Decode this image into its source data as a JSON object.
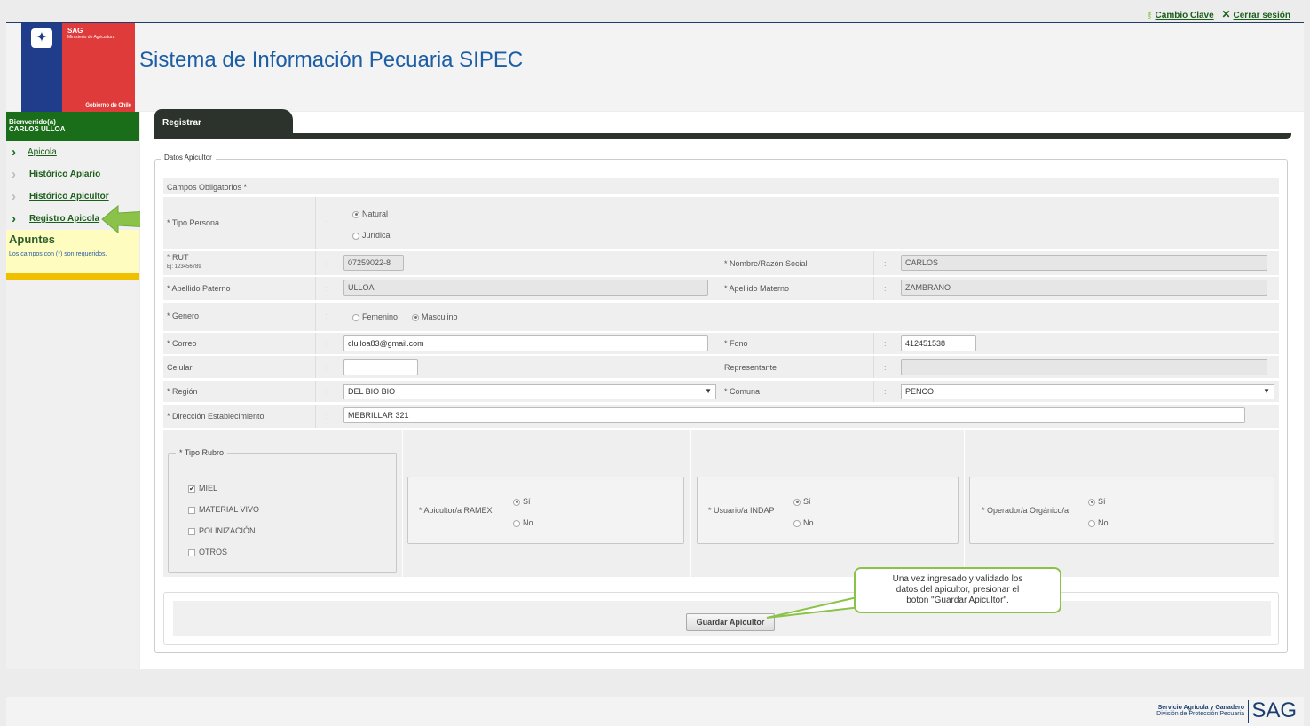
{
  "top_links": {
    "change_key": "Cambio Clave",
    "logout": "Cerrar sesión"
  },
  "logo": {
    "sag": "SAG",
    "ministry": "Ministerio de Agricultura",
    "gov": "Gobierno de Chile"
  },
  "header": {
    "title": "Sistema de Información Pecuaria SIPEC"
  },
  "sidebar": {
    "welcome_label": "Bienvenido(a)",
    "user_name": "CARLOS ULLOA",
    "items": [
      {
        "label": "Apicola"
      },
      {
        "label": "Histórico Apiario"
      },
      {
        "label": "Histórico Apicultor"
      },
      {
        "label": "Registro Apicola"
      }
    ],
    "notes_title": "Apuntes",
    "notes_text": "Los campos con (*) son requeridos."
  },
  "tab": {
    "label": "Registrar"
  },
  "form": {
    "legend": "Datos Apicultor",
    "required_note": "Campos Obligatorios *",
    "colon": ":",
    "tipo_persona": {
      "label": "* Tipo Persona",
      "options": [
        "Natural",
        "Jurídica"
      ],
      "selected": "Natural"
    },
    "rut": {
      "label": "* RUT",
      "hint": "Ej: 123456789",
      "value": "07259022-8"
    },
    "nombre": {
      "label": "* Nombre/Razón Social",
      "value": "CARLOS"
    },
    "apellido_paterno": {
      "label": "* Apellido Paterno",
      "value": "ULLOA"
    },
    "apellido_materno": {
      "label": "* Apellido Materno",
      "value": "ZAMBRANO"
    },
    "genero": {
      "label": "* Genero",
      "options": [
        "Femenino",
        "Masculino"
      ],
      "selected": "Masculino"
    },
    "correo": {
      "label": "* Correo",
      "value": "clulloa83@gmail.com"
    },
    "fono": {
      "label": "* Fono",
      "value": "412451538"
    },
    "celular": {
      "label": "Celular",
      "value": ""
    },
    "representante": {
      "label": "Representante",
      "value": ""
    },
    "region": {
      "label": "* Región",
      "value": "DEL BIO BIO"
    },
    "comuna": {
      "label": "* Comuna",
      "value": "PENCO"
    },
    "direccion": {
      "label": "* Dirección Establecimiento",
      "value": "MEBRILLAR 321"
    },
    "tipo_rubro": {
      "legend": "* Tipo Rubro",
      "options": [
        "MIEL",
        "MATERIAL VIVO",
        "POLINIZACIÓN",
        "OTROS"
      ],
      "checked": [
        "MIEL"
      ]
    },
    "ramex": {
      "label": "* Apicultor/a RAMEX",
      "yes": "Sí",
      "no": "No",
      "selected": "Sí"
    },
    "indap": {
      "label": "* Usuario/a INDAP",
      "yes": "Sí",
      "no": "No",
      "selected": "Sí"
    },
    "organico": {
      "label": "* Operador/a Orgánico/a",
      "yes": "Sí",
      "no": "No",
      "selected": "Sí"
    },
    "save_button": "Guardar Apicultor"
  },
  "tooltip": {
    "line1": "Una vez ingresado y validado los",
    "line2": "datos del apicultor, presionar el",
    "line3": "boton \"Guardar Apicultor\"."
  },
  "footer": {
    "line1": "Servicio Agrícola y Ganadero",
    "line2": "División de Protección Pecuaria",
    "brand": "SAG"
  },
  "colors": {
    "green": "#1a6e1a",
    "accent_arrow": "#8bc34a",
    "title_blue": "#1b5ea6",
    "tab_dark": "#2c332c"
  }
}
